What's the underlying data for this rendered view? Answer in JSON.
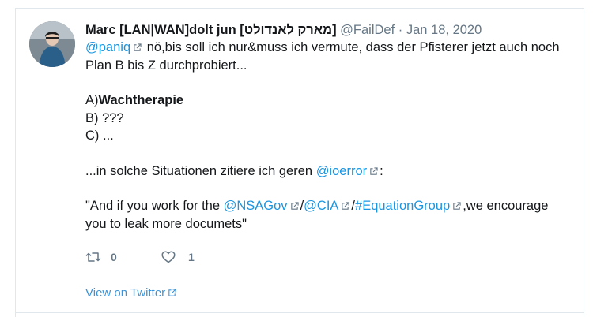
{
  "tweet": {
    "display_name": "Marc [LAN|WAN]dolt jun [מאַרק לאנדולט]",
    "handle": "@FailDef",
    "separator": "·",
    "date": "Jan 18, 2020",
    "body": {
      "mention_paniq": "@paniq",
      "line1_rest": "nö,bis soll ich nur&muss ich vermute, dass der Pfisterer jetzt auch noch",
      "line2": "Plan B bis Z durchprobiert...",
      "a_prefix": "A)",
      "a_bold": "Wachtherapie",
      "b_line": "B) ???",
      "c_line": "C) ...",
      "ioerror_prefix": "...in solche Situationen zitiere ich geren",
      "mention_ioerror": "@ioerror",
      "ioerror_suffix": ":",
      "quote_prefix": "\"And if you work for the",
      "mention_nsagov": "@NSAGov",
      "slash1": "/",
      "mention_cia": "@CIA",
      "slash2": "/",
      "hashtag_equation": "#EquationGroup",
      "quote_suffix": ",we encourage",
      "quote_line2": "you to leak more documets\""
    },
    "actions": {
      "retweet_count": "0",
      "like_count": "1"
    },
    "view_on_twitter": "View on Twitter"
  },
  "colors": {
    "link": "#1b95e0",
    "muted": "#657786",
    "text": "#14171a",
    "border": "#e1e8ed"
  },
  "icons": [
    "avatar",
    "external-link-icon",
    "retweet-icon",
    "heart-icon"
  ]
}
